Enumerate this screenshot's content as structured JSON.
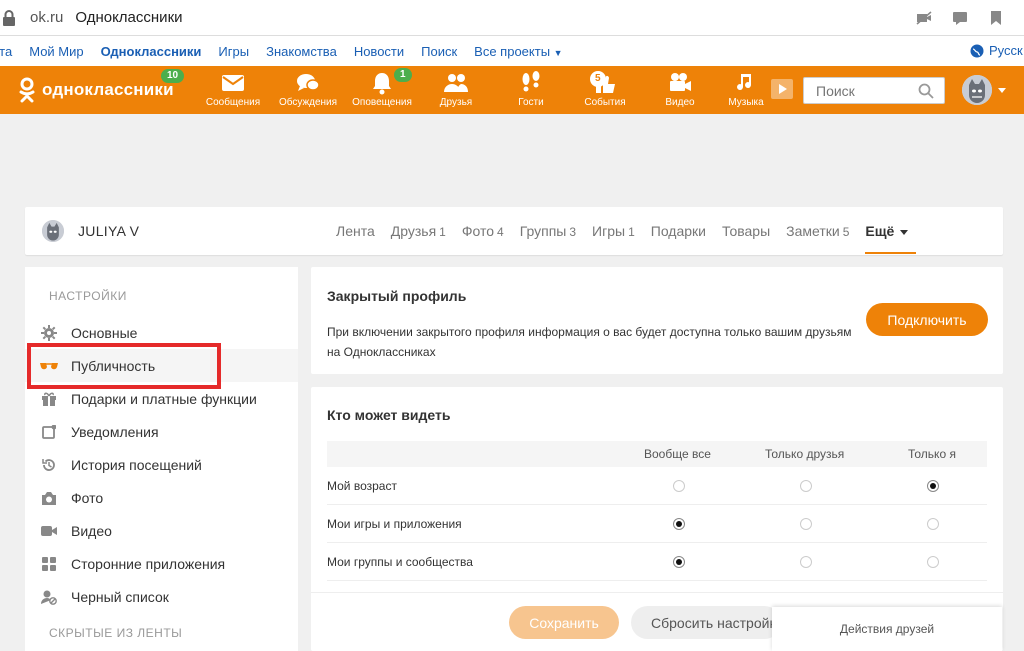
{
  "browser": {
    "domain": "ok.ru",
    "title": "Одноклассники"
  },
  "toplinks": {
    "items": [
      "нта",
      "Мой Мир",
      "Одноклассники",
      "Игры",
      "Знакомства",
      "Новости",
      "Поиск",
      "Все проекты"
    ],
    "language": "Русск"
  },
  "header": {
    "logo_text": "одноклассники",
    "logo_badge": "10",
    "nav": [
      {
        "label": "Сообщения",
        "icon": "envelope-icon"
      },
      {
        "label": "Обсуждения",
        "icon": "chat-icon"
      },
      {
        "label": "Оповещения",
        "icon": "bell-icon",
        "badge": "1"
      },
      {
        "label": "Друзья",
        "icon": "friends-icon"
      },
      {
        "label": "Гости",
        "icon": "footprints-icon"
      },
      {
        "label": "События",
        "icon": "thumbs-up-icon",
        "badge": "5"
      },
      {
        "label": "Видео",
        "icon": "video-camera-icon"
      },
      {
        "label": "Музыка",
        "icon": "music-note-icon"
      }
    ],
    "search_placeholder": "Поиск"
  },
  "profile": {
    "name": "JULIYA V",
    "tabs": [
      {
        "label": "Лента",
        "count": ""
      },
      {
        "label": "Друзья",
        "count": "1"
      },
      {
        "label": "Фото",
        "count": "4"
      },
      {
        "label": "Группы",
        "count": "3"
      },
      {
        "label": "Игры",
        "count": "1"
      },
      {
        "label": "Подарки",
        "count": ""
      },
      {
        "label": "Товары",
        "count": ""
      },
      {
        "label": "Заметки",
        "count": "5"
      }
    ],
    "more_label": "Ещё"
  },
  "sidebar": {
    "heading": "НАСТРОЙКИ",
    "items": [
      {
        "label": "Основные",
        "icon": "gear-icon"
      },
      {
        "label": "Публичность",
        "icon": "glasses-icon"
      },
      {
        "label": "Подарки и платные функции",
        "icon": "gift-icon"
      },
      {
        "label": "Уведомления",
        "icon": "notification-icon"
      },
      {
        "label": "История посещений",
        "icon": "history-icon"
      },
      {
        "label": "Фото",
        "icon": "camera-icon"
      },
      {
        "label": "Видео",
        "icon": "video-icon"
      },
      {
        "label": "Сторонние приложения",
        "icon": "apps-icon"
      },
      {
        "label": "Черный список",
        "icon": "block-user-icon"
      }
    ],
    "heading2": "СКРЫТЫЕ ИЗ ЛЕНТЫ"
  },
  "closed_profile": {
    "title": "Закрытый профиль",
    "description": "При включении закрытого профиля информация о вас будет доступна только вашим друзьям на Одноклассниках",
    "button": "Подключить"
  },
  "visibility": {
    "title": "Кто может видеть",
    "columns": [
      "Вообще все",
      "Только друзья",
      "Только я"
    ],
    "rows": [
      {
        "label": "Мой возраст",
        "selected": 2
      },
      {
        "label": "Мои игры и приложения",
        "selected": 0
      },
      {
        "label": "Мои группы и сообщества",
        "selected": 0
      }
    ],
    "save": "Сохранить",
    "reset": "Сбросить настройки"
  },
  "friends_actions": "Действия друзей",
  "colors": {
    "accent": "#ee8208",
    "badge": "#4cae4c",
    "highlight": "#e52a2a",
    "link": "#1a5fb4"
  }
}
